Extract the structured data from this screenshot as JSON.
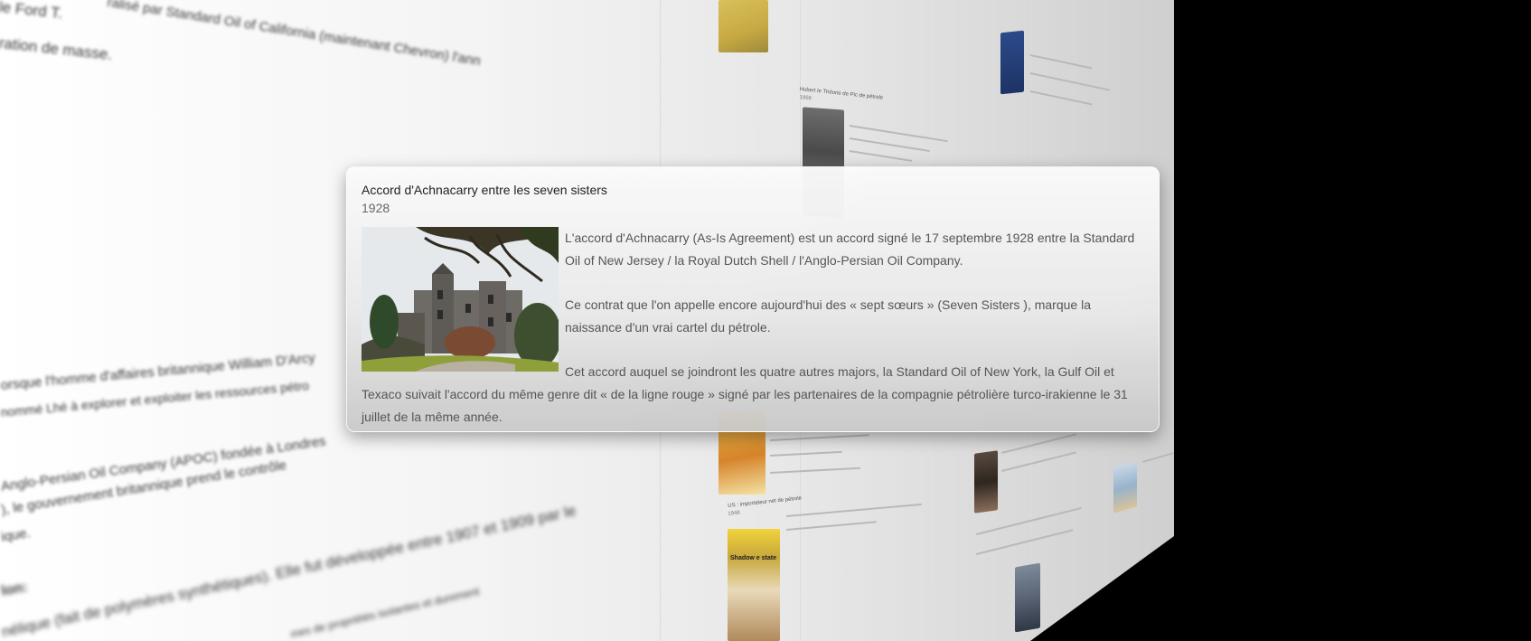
{
  "card": {
    "title": "Accord d'Achnacarry entre les seven sisters",
    "year": "1928",
    "photo_icon": "castle-photo",
    "paragraphs": [
      "L'accord d'Achnacarry (As-Is Agreement) est un accord signé le 17 septembre 1928 entre la Standard Oil of New Jersey / la Royal Dutch Shell / l'Anglo-Persian Oil Company.",
      "Ce contrat que l'on appelle encore aujourd'hui des « sept sœurs » (Seven Sisters ), marque la naissance d'un vrai cartel du pétrole.",
      "Cet accord auquel se joindront les quatre autres majors, la Standard Oil of New York, la Gulf Oil et Texaco suivait l'accord du même genre dit « de la ligne rouge » signé par les partenaires de la compagnie pétrolière turco-irakienne le 31 juillet de la même année."
    ]
  },
  "background": {
    "left_lines": [
      "le Ford T.",
      "ralisé par Standard Oil of California (maintenant Chevron) l'ann",
      "ration de masse.",
      "orsque l'homme d'affaires britannique William D'Arcy",
      "nommé Lhé à explorer et exploiter les ressources pétro",
      "Anglo-Persian Oil Company (APOC) fondée à Londres",
      "), le gouvernement britannique prend le contrôle",
      "ique.",
      "lon:",
      "nélique (fait de polymères synthétiques). Elle fut développée entre 1907 et 1909 par le",
      "mes de propriétés isolantes et durement"
    ],
    "right_entries": [
      "Hubert le Théorie de Pic de pétrole",
      "1956",
      "US : importateur net de pétrole",
      "1948",
      "Shadow e state"
    ]
  },
  "colors": {
    "backdrop": "#000000",
    "wall_light": "#ffffff",
    "wall_dark": "#cfcfcf",
    "card_text": "#555555",
    "card_title": "#222222"
  }
}
